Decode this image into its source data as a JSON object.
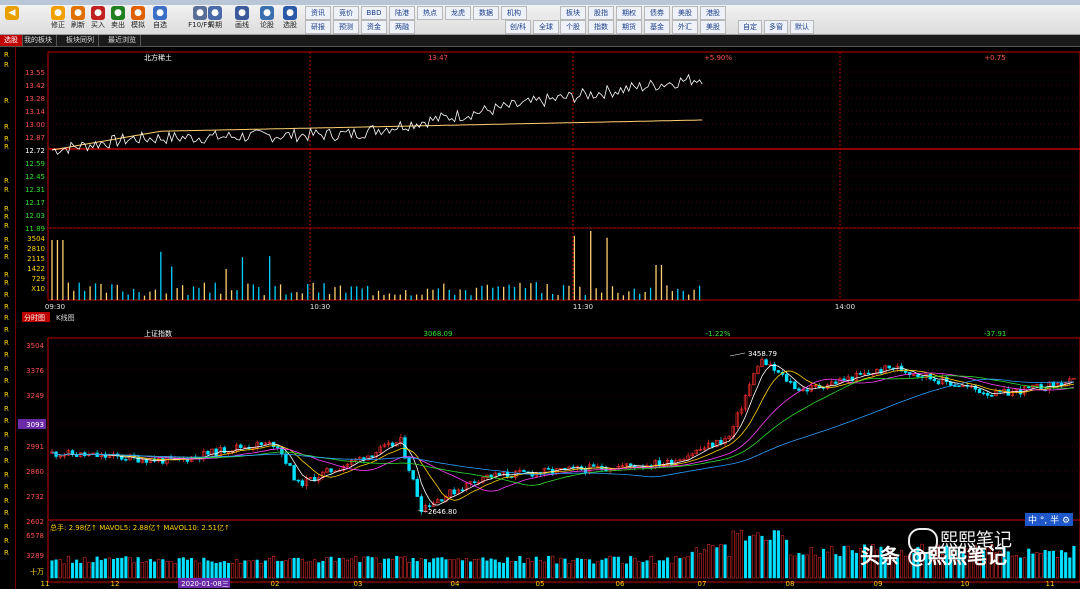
{
  "toolbar": {
    "buttons": [
      {
        "label": "",
        "icon": "back-arrow-icon"
      },
      {
        "label": "修正",
        "icon": "star-icon"
      },
      {
        "label": "刷新",
        "icon": "refresh-icon"
      },
      {
        "label": "买入",
        "icon": "buy-icon"
      },
      {
        "label": "卖出",
        "icon": "sell-icon"
      },
      {
        "label": "模拟",
        "icon": "simulate-icon"
      },
      {
        "label": "自选",
        "icon": "watchlist-icon"
      },
      {
        "label": "F10/F9",
        "icon": "f10-icon"
      },
      {
        "label": "周期",
        "icon": "period-icon"
      },
      {
        "label": "画线",
        "icon": "draw-line-icon"
      },
      {
        "label": "论股",
        "icon": "discuss-icon"
      },
      {
        "label": "选股",
        "icon": "stock-picker-icon"
      }
    ],
    "grid_top": [
      "资讯",
      "竞价",
      "BBD",
      "陆港",
      "热点",
      "龙虎",
      "数据",
      "机构"
    ],
    "grid_bottom": [
      "研报",
      "预测",
      "资金",
      "两融"
    ],
    "grid2_top": [
      "板块",
      "股指",
      "期权",
      "债券",
      "美股",
      "港股"
    ],
    "grid2_bottom": [
      "个股",
      "指数",
      "期货",
      "基金",
      "外汇",
      "美股"
    ],
    "right_buttons": [
      "自定",
      "多窗",
      "默认"
    ],
    "misc_labels": [
      "创/科",
      "全球"
    ]
  },
  "tabs": [
    "选股",
    "我的板块",
    "板块同列",
    "最近浏览"
  ],
  "intraday": {
    "stock_name": "北方稀土",
    "price": "13.47",
    "change_pct": "+5.90%",
    "change": "+0.75",
    "price_ticks": [
      "13.55",
      "13.42",
      "13.28",
      "13.14",
      "13.00",
      "12.87",
      "12.72",
      "12.59",
      "12.45",
      "12.31",
      "12.17",
      "12.03",
      "11.89"
    ],
    "volume_ticks": [
      "3504",
      "2810",
      "2115",
      "1422",
      "729",
      "X10"
    ],
    "time_ticks": [
      "09:30",
      "10:30",
      "11:30",
      "14:00"
    ]
  },
  "chart_tabs": [
    "分时图",
    "K线图"
  ],
  "kline": {
    "index_name": "上证指数",
    "price": "3068.09",
    "change_pct": "-1.22%",
    "change": "-37.91",
    "price_ticks": [
      "3504",
      "3376",
      "3249",
      "3093",
      "2991",
      "2860",
      "2732",
      "2602"
    ],
    "high_label": "3458.79",
    "low_label": "2646.80",
    "current_label": "3093",
    "volume_line": "总手: 2.98亿↑  MAVOL5: 2.88亿↑  MAVOL10: 2.51亿↑",
    "volume_ticks": [
      "6578",
      "3289",
      "十万"
    ],
    "month_ticks": [
      "11",
      "12",
      "2020-01-08三",
      "02",
      "03",
      "04",
      "05",
      "06",
      "07",
      "08",
      "09",
      "10",
      "11"
    ]
  },
  "left_r_labels": [
    "R",
    "R",
    "R",
    "R",
    "R",
    "R",
    "R",
    "R",
    "R",
    "R",
    "R",
    "R",
    "R",
    "R",
    "R",
    "R",
    "R",
    "R",
    "R",
    "R",
    "R",
    "R",
    "R",
    "R",
    "R",
    "R",
    "R",
    "R",
    "R",
    "R",
    "R",
    "R",
    "R",
    "R",
    "R",
    "R",
    "R"
  ],
  "watermark": {
    "top": "熙熙笔记",
    "bottom": "头条 @熙熙笔记"
  },
  "badge": "中 °, 半 ⚙",
  "colors": {
    "up": "#ff3030",
    "down": "#00e0ff",
    "white_line": "#ffffff",
    "avg_line": "#ffd070",
    "axis_red": "#c00000"
  }
}
